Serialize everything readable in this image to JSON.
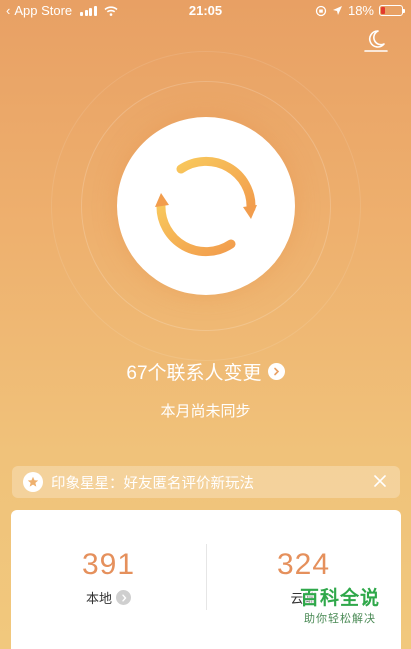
{
  "status_bar": {
    "back_app": "App Store",
    "time": "21:05",
    "battery": "18%",
    "battery_level": 0.18
  },
  "header": {
    "theme_icon": "moon-icon"
  },
  "sync": {
    "icon": "sync-arrows-icon",
    "contacts_changed": "67个联系人变更",
    "status": "本月尚未同步"
  },
  "banner": {
    "icon": "star-icon",
    "text": "印象星星：好友匿名评价新玩法",
    "close_icon": "close-icon"
  },
  "stats": {
    "local": {
      "count": "391",
      "label": "本地"
    },
    "cloud": {
      "count": "324",
      "label": "云端"
    }
  },
  "watermark": {
    "title": "百科全说",
    "subtitle": "助你轻松解决"
  },
  "colors": {
    "accent": "#e5905c",
    "ring_gradient_start": "#f4a54e",
    "ring_gradient_end": "#f8d36a"
  }
}
